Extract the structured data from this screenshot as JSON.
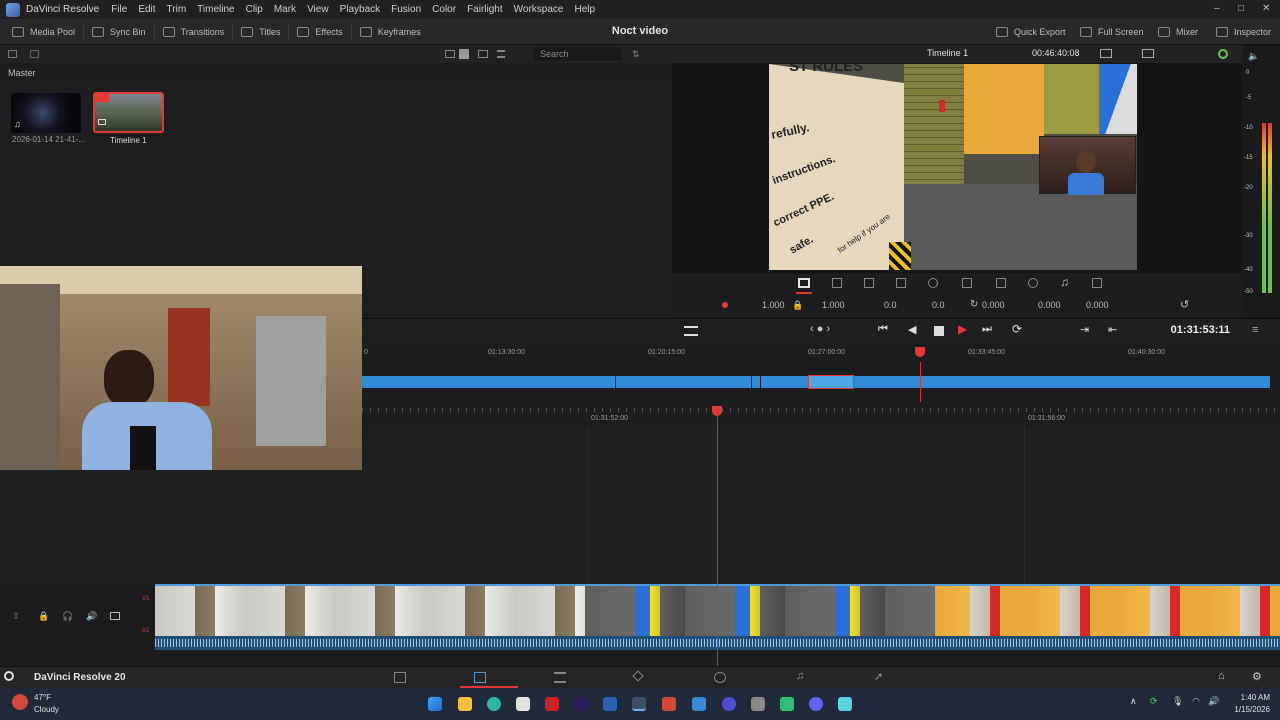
{
  "menubar": {
    "app_name": "DaVinci Resolve",
    "items": [
      "File",
      "Edit",
      "Trim",
      "Timeline",
      "Clip",
      "Mark",
      "View",
      "Playback",
      "Fusion",
      "Color",
      "Fairlight",
      "Workspace",
      "Help"
    ],
    "window_controls": [
      "–",
      "□",
      "✕"
    ]
  },
  "toolbar": {
    "media_pool": "Media Pool",
    "sync_bin": "Sync Bin",
    "transitions": "Transitions",
    "titles": "Titles",
    "effects": "Effects",
    "keyframes": "Keyframes",
    "quick_export": "Quick Export",
    "full_screen": "Full Screen",
    "mixer": "Mixer",
    "inspector": "Inspector"
  },
  "project": {
    "title": "Noct video"
  },
  "media_pool": {
    "search_placeholder": "Search",
    "bin_name": "Master",
    "clips": [
      {
        "name": "2026-01-14 21-41-..."
      },
      {
        "name": "Timeline 1"
      }
    ]
  },
  "viewer": {
    "timeline_name": "Timeline 1",
    "duration": "00:46:40:08",
    "frame_text": [
      "ST RULES",
      "refully.",
      "instructions.",
      "correct PPE.",
      "safe.",
      "for help if you are"
    ]
  },
  "transform": {
    "zoom_x": "1.000",
    "zoom_y": "1.000",
    "pos_x": "0.0",
    "pos_y": "0.0",
    "rotation": "0.000",
    "pitch": "0.000",
    "yaw": "0.000"
  },
  "meter": {
    "ticks": [
      "0",
      "-5",
      "-10",
      "-15",
      "-20",
      "-30",
      "-40",
      "-50"
    ]
  },
  "transport": {
    "timecode": "01:31:53:11"
  },
  "timeline": {
    "upper_ruler": [
      "0",
      "01:13:30:00",
      "01:20:15:00",
      "01:27:00:00",
      "01:33:45:00",
      "01:40:30:00"
    ],
    "lower_ruler": [
      "01:31:52:00",
      "01:31:56:00"
    ],
    "track_video_label": "V1",
    "track_audio_label": "A1"
  },
  "page_bar": {
    "brand": "DaVinci Resolve 20"
  },
  "taskbar": {
    "temperature": "47°F",
    "condition": "Cloudy",
    "time": "1:40 AM",
    "date": "1/15/2026"
  }
}
